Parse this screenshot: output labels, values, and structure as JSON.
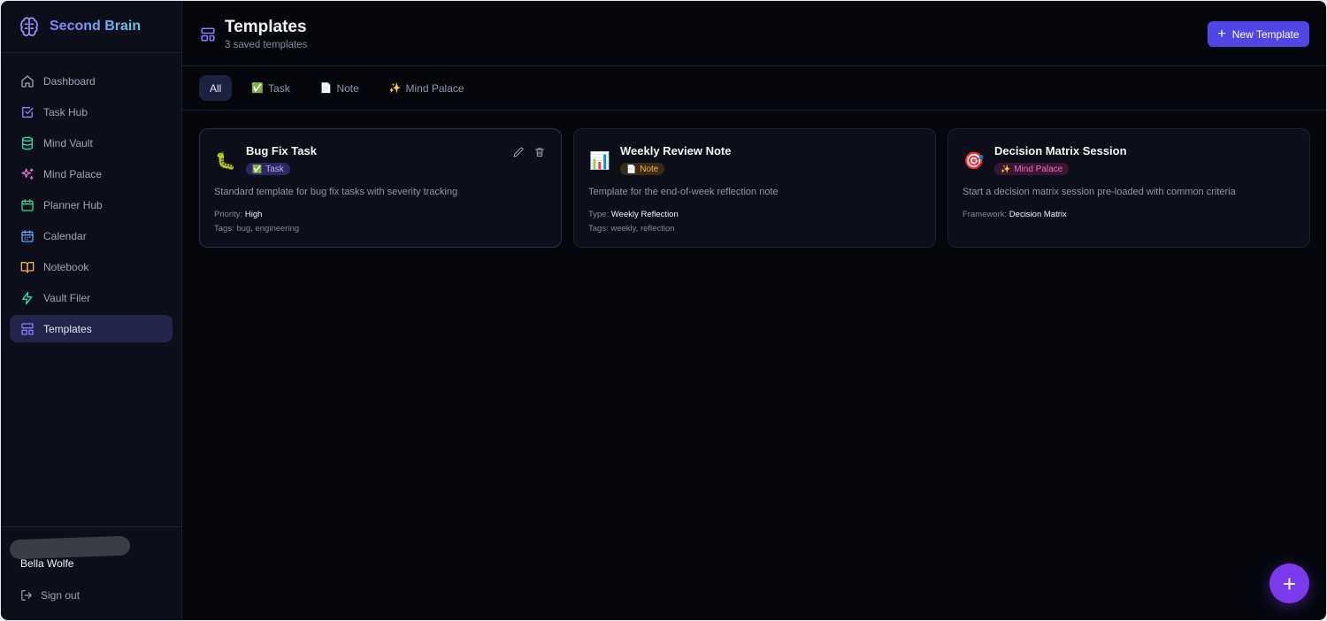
{
  "app": {
    "name": "Second Brain",
    "accent": "#4f46e5",
    "active_color": "#21254a"
  },
  "sidebar": {
    "items": [
      {
        "label": "Dashboard",
        "icon": "home-icon",
        "color": "#9aa4ba"
      },
      {
        "label": "Task Hub",
        "icon": "checkbox-icon",
        "color": "#8b7bff"
      },
      {
        "label": "Mind Vault",
        "icon": "database-icon",
        "color": "#2dd4bf"
      },
      {
        "label": "Mind Palace",
        "icon": "sparkles-icon",
        "color": "#ec6fc2"
      },
      {
        "label": "Planner Hub",
        "icon": "calendar-check-icon",
        "color": "#34d399"
      },
      {
        "label": "Calendar",
        "icon": "calendar-icon",
        "color": "#60a5fa"
      },
      {
        "label": "Notebook",
        "icon": "book-open-icon",
        "color": "#f1b349"
      },
      {
        "label": "Vault Filer",
        "icon": "lightning-icon",
        "color": "#2dd4bf"
      },
      {
        "label": "Templates",
        "icon": "layout-icon",
        "color": "#8b7bff",
        "active": true
      }
    ],
    "user_name": "Bella Wolfe",
    "signout_label": "Sign out"
  },
  "header": {
    "title": "Templates",
    "subtitle": "3 saved templates",
    "new_button_label": "New Template"
  },
  "filters": [
    {
      "label": "All",
      "emoji": "",
      "active": true
    },
    {
      "label": "Task",
      "emoji": "✅"
    },
    {
      "label": "Note",
      "emoji": "📄"
    },
    {
      "label": "Mind Palace",
      "emoji": "✨"
    }
  ],
  "cards": [
    {
      "icon_emoji": "🐛",
      "title": "Bug Fix Task",
      "badge": {
        "emoji": "✅",
        "label": "Task"
      },
      "description": "Standard template for bug fix tasks with severity tracking",
      "meta": [
        {
          "key": "Priority:",
          "value": "High"
        },
        {
          "key": "Tags:",
          "value": "bug, engineering"
        }
      ]
    },
    {
      "icon_emoji": "📊",
      "title": "Weekly Review Note",
      "badge": {
        "emoji": "📄",
        "label": "Note"
      },
      "description": "Template for the end-of-week reflection note",
      "meta": [
        {
          "key": "Type:",
          "value": "Weekly Reflection"
        },
        {
          "key": "Tags:",
          "value": "weekly, reflection"
        }
      ]
    },
    {
      "icon_emoji": "🎯",
      "title": "Decision Matrix Session",
      "badge": {
        "emoji": "✨",
        "label": "Mind Palace"
      },
      "description": "Start a decision matrix session pre-loaded with common criteria",
      "meta": [
        {
          "key": "Framework:",
          "value": "Decision Matrix"
        }
      ]
    }
  ],
  "fab_label": "+"
}
